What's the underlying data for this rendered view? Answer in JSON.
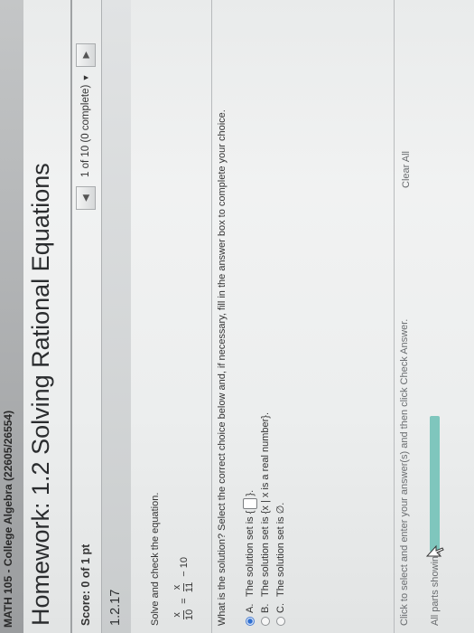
{
  "course": "MATH 105 - College Algebra (22605/26554)",
  "homework_title": "Homework: 1.2 Solving Rational Equations",
  "score": "Score: 0 of 1 pt",
  "question_nav": {
    "progress": "1 of 10 (0 complete)",
    "dropdown_glyph": "▼",
    "prev_glyph": "◀",
    "next_glyph": "▶"
  },
  "section_number": "1.2.17",
  "instruction": "Solve and check the equation.",
  "equation": {
    "lhs_num": "x",
    "lhs_den": "10",
    "equals": "=",
    "rhs_num": "x",
    "rhs_den": "11",
    "rhs_tail": "− 10"
  },
  "question": "What is the solution? Select the correct choice below and, if necessary, fill in the answer box to complete your choice.",
  "choices": [
    {
      "letter": "A.",
      "text_before": "The solution set is {",
      "text_after": "}.",
      "selected": true
    },
    {
      "letter": "B.",
      "text": "The solution set is {x | x is a real number}.",
      "selected": false
    },
    {
      "letter": "C.",
      "text": "The solution set is ∅.",
      "selected": false
    }
  ],
  "footer_note": "Click to select and enter your answer(s) and then click Check Answer.",
  "parts_label": "All parts showing",
  "clear_all": "Clear All",
  "colors": {
    "radio_selected": "#2f6fd1",
    "parts_bar": "#7fc6bd"
  }
}
